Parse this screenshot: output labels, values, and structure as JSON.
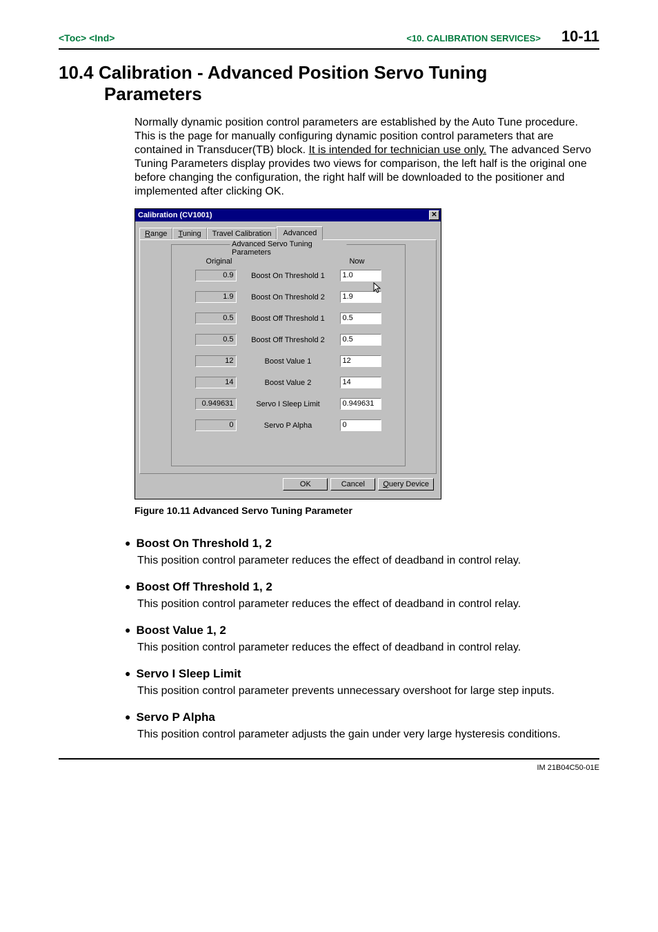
{
  "header": {
    "left_toc": "<Toc>",
    "left_ind": "<Ind>",
    "chapter": "<10.  CALIBRATION SERVICES>",
    "page_num": "10-11"
  },
  "section": {
    "number": "10.4",
    "title_line1": "Calibration - Advanced Position Servo Tuning",
    "title_line2": "Parameters"
  },
  "intro": {
    "part1": "Normally dynamic position control parameters are established by the Auto Tune procedure. This is the page for manually configuring dynamic position control parameters that are contained in Transducer(TB) block.  ",
    "underlined": "It is intended for technician use only.",
    "part2": "  The advanced Servo Tuning Parameters display provides two views for comparison, the left half is the original one before changing the configuration, the right half will be downloaded to the positioner and implemented after clicking OK."
  },
  "dialog": {
    "title": "Calibration (CV1001)",
    "tabs": {
      "range": "Range",
      "tuning": "Tuning",
      "travel": "Travel Calibration",
      "advanced": "Advanced"
    },
    "legend": "Advanced Servo Tuning Parameters",
    "col_original": "Original",
    "col_now": "Now",
    "rows": [
      {
        "orig": "0.9",
        "label": "Boost On Threshold 1",
        "now": "1.0"
      },
      {
        "orig": "1.9",
        "label": "Boost On Threshold 2",
        "now": "1.9"
      },
      {
        "orig": "0.5",
        "label": "Boost Off Threshold 1",
        "now": "0.5"
      },
      {
        "orig": "0.5",
        "label": "Boost Off Threshold 2",
        "now": "0.5"
      },
      {
        "orig": "12",
        "label": "Boost Value 1",
        "now": "12"
      },
      {
        "orig": "14",
        "label": "Boost Value 2",
        "now": "14"
      },
      {
        "orig": "0.949631",
        "label": "Servo I Sleep Limit",
        "now": "0.949631"
      },
      {
        "orig": "0",
        "label": "Servo P Alpha",
        "now": "0"
      }
    ],
    "buttons": {
      "ok": "OK",
      "cancel": "Cancel",
      "query_prefix": "Q",
      "query_rest": "uery Device"
    }
  },
  "figure_caption": "Figure 10.11 Advanced Servo Tuning Parameter",
  "bullets": [
    {
      "title": "Boost On Threshold 1, 2",
      "body": "This position control parameter reduces the effect of deadband in control relay."
    },
    {
      "title": "Boost Off Threshold 1, 2",
      "body": "This position control parameter reduces the effect of deadband in control relay."
    },
    {
      "title": "Boost Value 1, 2",
      "body": "This position control parameter reduces the effect of deadband in control relay."
    },
    {
      "title": "Servo I Sleep Limit",
      "body": "This position control parameter prevents unnecessary overshoot for large step inputs."
    },
    {
      "title": "Servo P Alpha",
      "body": "This position control parameter adjusts the gain under very large hysteresis conditions."
    }
  ],
  "footer": "IM 21B04C50-01E"
}
